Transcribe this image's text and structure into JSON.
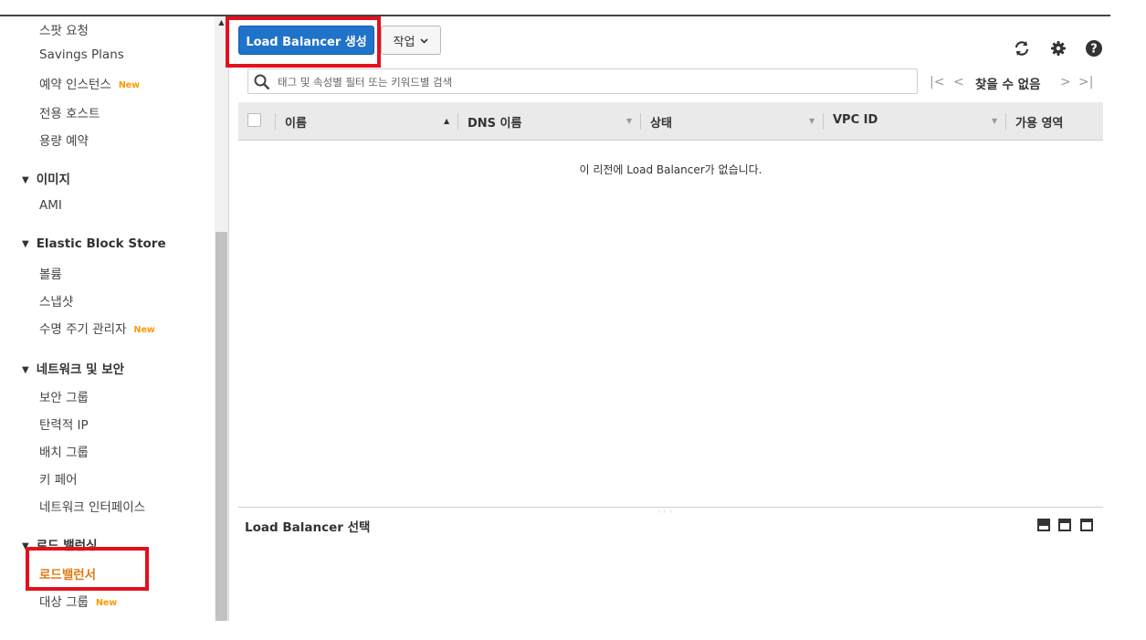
{
  "sidebar": {
    "items_top": [
      {
        "label": "스팟 요청",
        "new": false
      },
      {
        "label": "Savings Plans",
        "new": false
      },
      {
        "label": "예약 인스턴스",
        "new": true
      },
      {
        "label": "전용 호스트",
        "new": false
      },
      {
        "label": "용량 예약",
        "new": false
      }
    ],
    "new_badge": "New",
    "sections": {
      "images": {
        "title": "이미지",
        "items": [
          "AMI"
        ]
      },
      "ebs": {
        "title": "Elastic Block Store",
        "items": [
          "볼륨",
          "스냅샷",
          "수명 주기 관리자"
        ]
      },
      "network": {
        "title": "네트워크 및 보안",
        "items": [
          "보안 그룹",
          "탄력적 IP",
          "배치 그룹",
          "키 페어",
          "네트워크 인터페이스"
        ]
      },
      "lb": {
        "title": "로드 밸런싱",
        "items": [
          "로드밸런서",
          "대상 그룹"
        ]
      }
    }
  },
  "toolbar": {
    "create_label": "Load Balancer 생성",
    "actions_label": "작업"
  },
  "search": {
    "placeholder": "태그 및 속성별 필터 또는 키워드별 검색"
  },
  "pagination": {
    "status": "찾을 수 없음"
  },
  "table": {
    "columns": [
      "이름",
      "DNS 이름",
      "상태",
      "VPC ID",
      "가용 영역"
    ],
    "empty_message": "이 리전에 Load Balancer가 없습니다."
  },
  "detail_panel": {
    "title": "Load Balancer 선택"
  },
  "colors": {
    "primary_button": "#1f73c9",
    "highlight": "#e3101e",
    "active_nav": "#e07b15",
    "new_badge": "#ff9900"
  }
}
